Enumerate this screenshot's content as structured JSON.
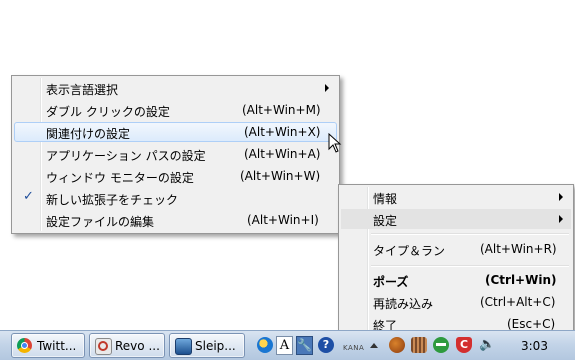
{
  "main_menu": {
    "items": [
      {
        "label": "表示言語選択",
        "shortcut": "",
        "submenu": true,
        "checked": false,
        "highlighted": false
      },
      {
        "label": "ダブル クリックの設定",
        "shortcut": "(Alt+Win+M)",
        "submenu": false,
        "checked": false,
        "highlighted": false
      },
      {
        "label": "関連付けの設定",
        "shortcut": "(Alt+Win+X)",
        "submenu": false,
        "checked": false,
        "highlighted": true
      },
      {
        "label": "アプリケーション パスの設定",
        "shortcut": "(Alt+Win+A)",
        "submenu": false,
        "checked": false,
        "highlighted": false
      },
      {
        "label": "ウィンドウ モニターの設定",
        "shortcut": "(Alt+Win+W)",
        "submenu": false,
        "checked": false,
        "highlighted": false
      },
      {
        "label": "新しい拡張子をチェック",
        "shortcut": "",
        "submenu": false,
        "checked": true,
        "highlighted": false
      },
      {
        "label": "設定ファイルの編集",
        "shortcut": "(Alt+Win+I)",
        "submenu": false,
        "checked": false,
        "highlighted": false
      }
    ]
  },
  "tray_menu": {
    "items": [
      {
        "label": "情報",
        "shortcut": "",
        "submenu": true
      },
      {
        "label": "設定",
        "shortcut": "",
        "submenu": true
      },
      {
        "label": "タイプ＆ラン",
        "shortcut": "(Alt+Win+R)",
        "submenu": false
      },
      {
        "label": "ポーズ",
        "shortcut": "(Ctrl+Win)",
        "submenu": false
      },
      {
        "label": "再読み込み",
        "shortcut": "(Ctrl+Alt+C)",
        "submenu": false
      },
      {
        "label": "終了",
        "shortcut": "(Esc+C)",
        "submenu": false
      }
    ]
  },
  "taskbar": {
    "buttons": [
      {
        "label": "Twitt...",
        "icon": "chrome-icon"
      },
      {
        "label": "Revo ...",
        "icon": "revo-uninstaller-icon"
      },
      {
        "label": "Sleip...",
        "icon": "sleipnir-icon"
      }
    ],
    "ime_mode": "A",
    "ime_kana": "KANA",
    "clock": "3:03"
  },
  "colors": {
    "menu_bg": "#f0f0f0",
    "highlight": "#dcebfc",
    "check": "#1f4e9b",
    "taskbar": "#c3d4e8"
  }
}
